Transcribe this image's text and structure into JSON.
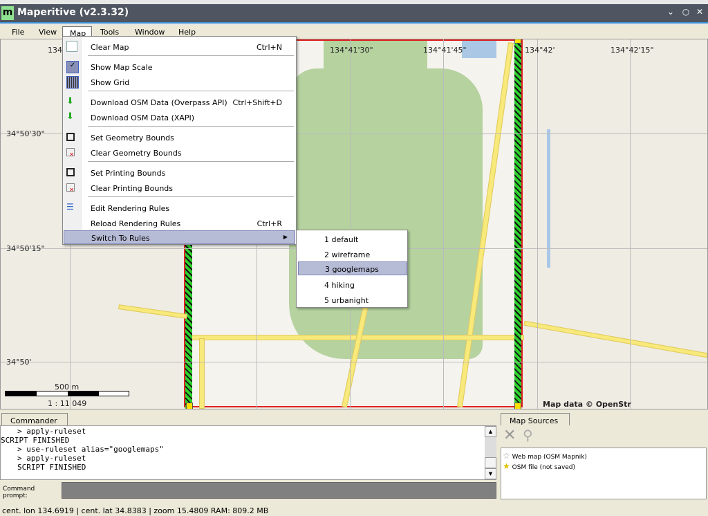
{
  "window": {
    "title": "Maperitive (v2.3.32)",
    "logo": "m"
  },
  "menubar": [
    "File",
    "View",
    "Map",
    "Tools",
    "Window",
    "Help"
  ],
  "map": {
    "top_labels": [
      "134",
      "134°41'30\"",
      "134°41'45\"",
      "134°42'",
      "134°42'15\""
    ],
    "left_labels": [
      "34°50'30\"",
      "34°50'15\"",
      "34°50'"
    ],
    "scale_label": "500 m",
    "scale_ratio": "1 : 11 049",
    "attribution": "Map data © OpenStr"
  },
  "map_menu": {
    "items": [
      {
        "label": "Clear Map",
        "shortcut": "Ctrl+N",
        "icon": "document-icon"
      },
      {
        "label": "Show Map Scale",
        "icon": "check-icon",
        "checked": true
      },
      {
        "label": "Show Grid",
        "icon": "grid-icon",
        "checked": true
      },
      {
        "label": "Download OSM Data (Overpass API)",
        "shortcut": "Ctrl+Shift+D",
        "icon": "download-icon"
      },
      {
        "label": "Download OSM Data (XAPI)",
        "icon": "download-icon"
      },
      {
        "label": "Set Geometry Bounds",
        "icon": "box-icon"
      },
      {
        "label": "Clear Geometry Bounds",
        "icon": "clear-box-icon"
      },
      {
        "label": "Set Printing Bounds",
        "icon": "box-icon"
      },
      {
        "label": "Clear Printing Bounds",
        "icon": "clear-box-icon"
      },
      {
        "label": "Edit Rendering Rules",
        "icon": "rules-icon"
      },
      {
        "label": "Reload Rendering Rules",
        "shortcut": "Ctrl+R"
      },
      {
        "label": "Switch To Rules",
        "submenu": true
      }
    ],
    "submenu": [
      "1 default",
      "2 wireframe",
      "3 googlemaps",
      "4 hiking",
      "5 urbanight"
    ],
    "submenu_selected": "3 googlemaps"
  },
  "commander": {
    "tab": "Commander",
    "lines": [
      "> apply-ruleset",
      "SCRIPT FINISHED",
      "> use-ruleset alias=\"googlemaps\"",
      "> apply-ruleset",
      "SCRIPT FINISHED"
    ],
    "prompt_label": "Command prompt:",
    "prompt_value": ""
  },
  "sources": {
    "tab": "Map Sources",
    "items": [
      "Web map (OSM Mapnik)",
      "OSM file (not saved)"
    ]
  },
  "status": "cent. lon 134.6919 | cent. lat 34.8383 | zoom 15.4809   RAM: 809.2 MB"
}
